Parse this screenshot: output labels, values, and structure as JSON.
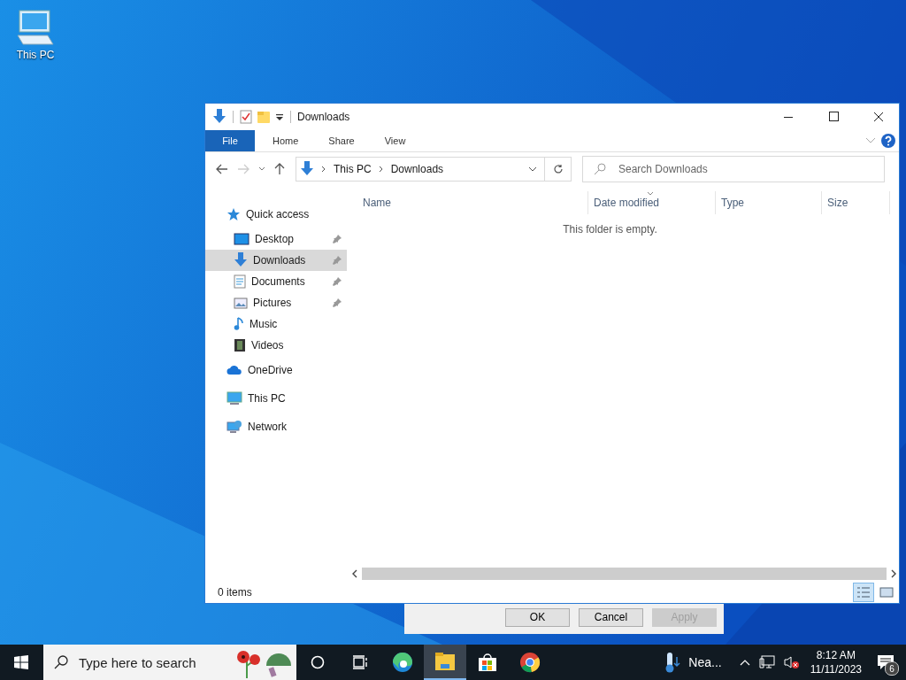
{
  "desktop_icons": [
    {
      "label": "This PC"
    }
  ],
  "dialog": {
    "buttons": [
      {
        "label": "OK",
        "disabled": false
      },
      {
        "label": "Cancel",
        "disabled": false
      },
      {
        "label": "Apply",
        "disabled": true
      }
    ]
  },
  "explorer": {
    "title": "Downloads",
    "ribbon_tabs": [
      {
        "label": "File",
        "kind": "file"
      },
      {
        "label": "Home",
        "kind": "tab"
      },
      {
        "label": "Share",
        "kind": "tab"
      },
      {
        "label": "View",
        "kind": "tab"
      }
    ],
    "address": [
      "This PC",
      "Downloads"
    ],
    "search": {
      "placeholder": "Search Downloads"
    },
    "columns": [
      {
        "label": "Name",
        "sorted": false
      },
      {
        "label": "Date modified",
        "sorted": true
      },
      {
        "label": "Type",
        "sorted": false
      },
      {
        "label": "Size",
        "sorted": false
      }
    ],
    "empty_message": "This folder is empty.",
    "nav": [
      {
        "label": "Quick access",
        "children": [
          {
            "label": "Desktop",
            "selected": false,
            "pinned": true
          },
          {
            "label": "Downloads",
            "selected": true,
            "pinned": true
          },
          {
            "label": "Documents",
            "selected": false,
            "pinned": true
          },
          {
            "label": "Pictures",
            "selected": false,
            "pinned": true
          },
          {
            "label": "Music",
            "selected": false,
            "pinned": false
          },
          {
            "label": "Videos",
            "selected": false,
            "pinned": false
          }
        ]
      },
      {
        "label": "OneDrive"
      },
      {
        "label": "This PC"
      },
      {
        "label": "Network"
      }
    ],
    "status": "0 items",
    "views": [
      {
        "selected": true
      },
      {
        "selected": false
      }
    ]
  },
  "taskbar": {
    "search": {
      "placeholder": "Type here to search"
    },
    "apps": [
      {
        "active": false
      },
      {
        "active": false
      },
      {
        "active": false
      },
      {
        "active": true
      },
      {
        "active": false
      },
      {
        "active": false
      }
    ],
    "weather": "Nea...",
    "volume_muted": true,
    "time": "8:12 AM",
    "date": "11/11/2023",
    "notifications": "6"
  }
}
